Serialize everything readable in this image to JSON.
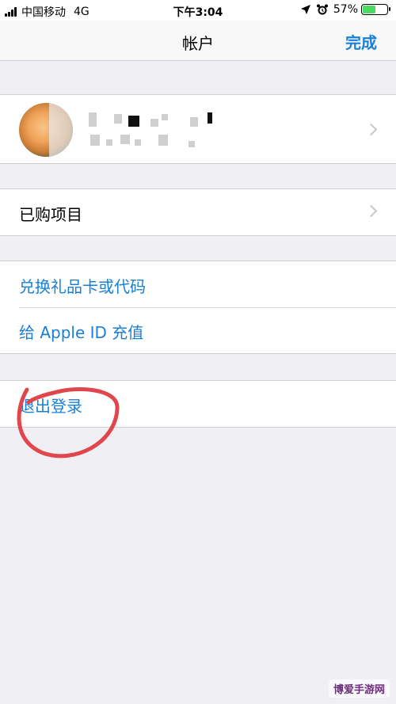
{
  "status_bar": {
    "carrier": "中国移动",
    "network": "4G",
    "time": "下午3:04",
    "battery_percent": "57%",
    "battery_level": 0.57,
    "battery_color": "#4cd964"
  },
  "nav": {
    "title": "帐户",
    "done_label": "完成"
  },
  "profile": {
    "avatar": "rose-photo-avatar",
    "name_obscured": true
  },
  "groups": {
    "purchased": {
      "label": "已购项目"
    },
    "redeem": {
      "label": "兑换礼品卡或代码"
    },
    "add_funds": {
      "label": "给 Apple ID 充值"
    },
    "sign_out": {
      "label": "退出登录"
    }
  },
  "colors": {
    "accent": "#1a7fd6",
    "background": "#efeff4",
    "annotation": "#e0474c"
  },
  "watermark": {
    "text": "博爱手游网"
  }
}
